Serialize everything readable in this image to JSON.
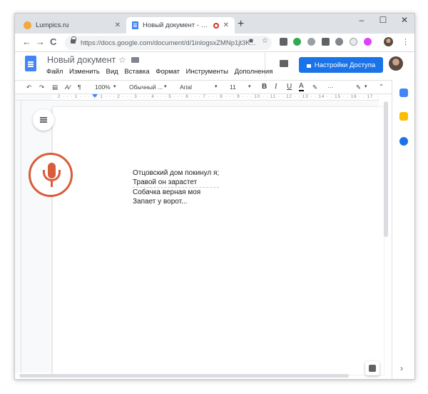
{
  "browser": {
    "tabs": [
      {
        "title": "Lumpics.ru",
        "close": "✕"
      },
      {
        "title": "Новый документ - Google ...",
        "close": "✕"
      }
    ],
    "new_tab": "+",
    "controls": {
      "minimize": "–",
      "maximize": "☐",
      "close": "✕"
    },
    "nav": {
      "back": "←",
      "forward": "→",
      "reload": "C"
    },
    "url": "https://docs.google.com/document/d/1inlogsxZMNp1jt3K..."
  },
  "docs": {
    "title": "Новый документ",
    "menu": [
      "Файл",
      "Изменить",
      "Вид",
      "Вставка",
      "Формат",
      "Инструменты",
      "Дополнения"
    ],
    "share_label": "Настройки Доступа",
    "toolbar": {
      "zoom": "100%",
      "style": "Обычный ...",
      "font": "Arial",
      "size": "11",
      "bold": "B",
      "italic": "I",
      "underline": "U",
      "text_color": "A",
      "more": "···"
    },
    "ruler_numbers": "2 · · · 1 · · · · · 1 · · · 2 · · · 3 · · · 4 · · · 5 · · · 6 · · · 7 · · · 8 · · · 9 · · · 10 · · 11 · · 12 · · 13 · · 14 · · 15 · · 16 · · 17",
    "body_lines": [
      "Отцовский дом покинул я;",
      "Травой он зарастет",
      "Собачка верная моя",
      "Запает у ворот..."
    ]
  },
  "colors": {
    "accent": "#1a73e8",
    "mic": "#d95c3b",
    "docs_blue": "#4285f4"
  }
}
